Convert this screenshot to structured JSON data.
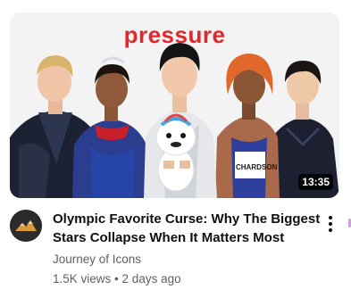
{
  "video": {
    "thumbnail_text": "pressure",
    "duration": "13:35",
    "title": "Olympic Favorite Curse: Why The Biggest Stars Collapse When It Matters Most",
    "channel": "Journey of Icons",
    "views": "1.5K views",
    "separator": "•",
    "age": "2 days ago",
    "shirt_label": "CHARDSON"
  },
  "icons": {
    "more": "more-vert-icon",
    "avatar": "mountain-logo-icon"
  },
  "colors": {
    "thumbnail_text": "#e3262b",
    "title": "#0f0f0f",
    "meta": "#606060"
  }
}
